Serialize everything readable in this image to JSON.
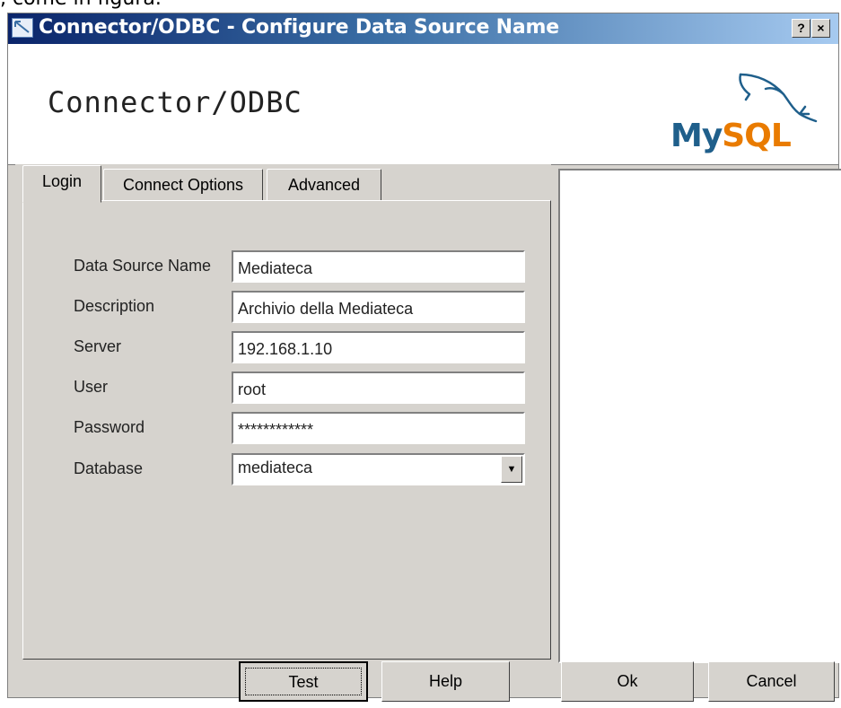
{
  "page_caption": ", come in figura.",
  "window": {
    "title": "Connector/ODBC - Configure Data Source Name",
    "help_button": "?",
    "close_button": "×"
  },
  "header": {
    "title": "Connector/ODBC",
    "logo_my": "My",
    "logo_sql": "SQL"
  },
  "tabs": [
    {
      "label": "Login",
      "active": true
    },
    {
      "label": "Connect Options",
      "active": false
    },
    {
      "label": "Advanced",
      "active": false
    }
  ],
  "form": {
    "fields": [
      {
        "label": "Data Source Name",
        "value": "Mediateca"
      },
      {
        "label": "Description",
        "value": "Archivio della Mediateca"
      },
      {
        "label": "Server",
        "value": "192.168.1.10"
      },
      {
        "label": "User",
        "value": "root"
      },
      {
        "label": "Password",
        "value": "************"
      },
      {
        "label": "Database",
        "value": "mediateca"
      }
    ]
  },
  "buttons": {
    "test": "Test",
    "help": "Help",
    "ok": "Ok",
    "cancel": "Cancel"
  },
  "colors": {
    "dialog_bg": "#d6d3ce",
    "title_bar_start": "#0a246a",
    "title_bar_end": "#a6caf0",
    "mysql_blue": "#1f5f8b",
    "mysql_orange": "#e97b00"
  }
}
